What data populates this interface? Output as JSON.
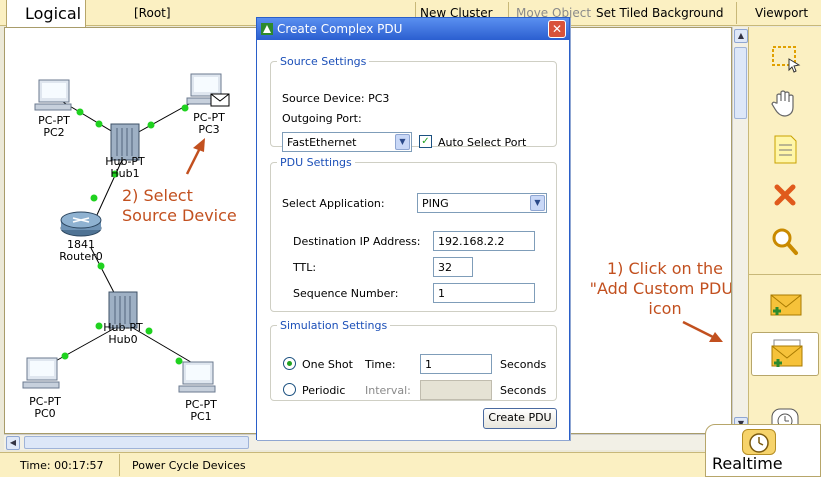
{
  "topbar": {
    "logical": "Logical",
    "root": "[Root]",
    "new_cluster": "New Cluster",
    "move_object": "Move Object",
    "set_tiled_background": "Set Tiled Background",
    "viewport": "Viewport"
  },
  "topology": {
    "devices": [
      {
        "name": "pc2",
        "type": "PC-PT",
        "label": "PC2"
      },
      {
        "name": "pc3",
        "type": "PC-PT",
        "label": "PC3"
      },
      {
        "name": "hub1",
        "type": "Hub-PT",
        "label": "Hub1"
      },
      {
        "name": "router0",
        "type": "1841",
        "label": "Router0"
      },
      {
        "name": "hub0",
        "type": "Hub-PT",
        "label": "Hub0"
      },
      {
        "name": "pc0",
        "type": "PC-PT",
        "label": "PC0"
      },
      {
        "name": "pc1",
        "type": "PC-PT",
        "label": "PC1"
      }
    ],
    "link_color": "#1fd21f"
  },
  "annotations": {
    "select_source_line1": "2) Select",
    "select_source_line2": "Source Device",
    "click_line1": "1) Click on the",
    "click_line2": "\"Add Custom PDU\"",
    "click_line3": "icon",
    "color": "#c2501f"
  },
  "dialog": {
    "title": "Create Complex PDU",
    "close_label": "✕",
    "source": {
      "legend": "Source Settings",
      "source_device_label": "Source Device: PC3",
      "outgoing_port_label": "Outgoing Port:",
      "outgoing_port_value": "FastEthernet",
      "auto_select_label": "Auto Select Port",
      "auto_select_checked": true
    },
    "pdu": {
      "legend": "PDU Settings",
      "select_app_label": "Select Application:",
      "select_app_value": "PING",
      "dest_ip_label": "Destination IP Address:",
      "dest_ip_value": "192.168.2.2",
      "ttl_label": "TTL:",
      "ttl_value": "32",
      "seq_label": "Sequence Number:",
      "seq_value": "1"
    },
    "simulation": {
      "legend": "Simulation Settings",
      "one_shot_label": "One Shot",
      "time_label": "Time:",
      "time_value": "1",
      "seconds_label_1": "Seconds",
      "periodic_label": "Periodic",
      "interval_label": "Interval:",
      "interval_value": "",
      "seconds_label_2": "Seconds",
      "selected_mode": "One Shot"
    },
    "create_button": "Create PDU"
  },
  "statusbar": {
    "time": "Time: 00:17:57",
    "power_cycle": "Power Cycle Devices",
    "realtime": "Realtime"
  },
  "toolbar": {
    "tools": [
      "select-icon",
      "move-hand-icon",
      "note-icon",
      "delete-icon",
      "inspect-icon",
      "add-simple-pdu-icon",
      "add-complex-pdu-icon",
      "simulation-icon"
    ]
  }
}
